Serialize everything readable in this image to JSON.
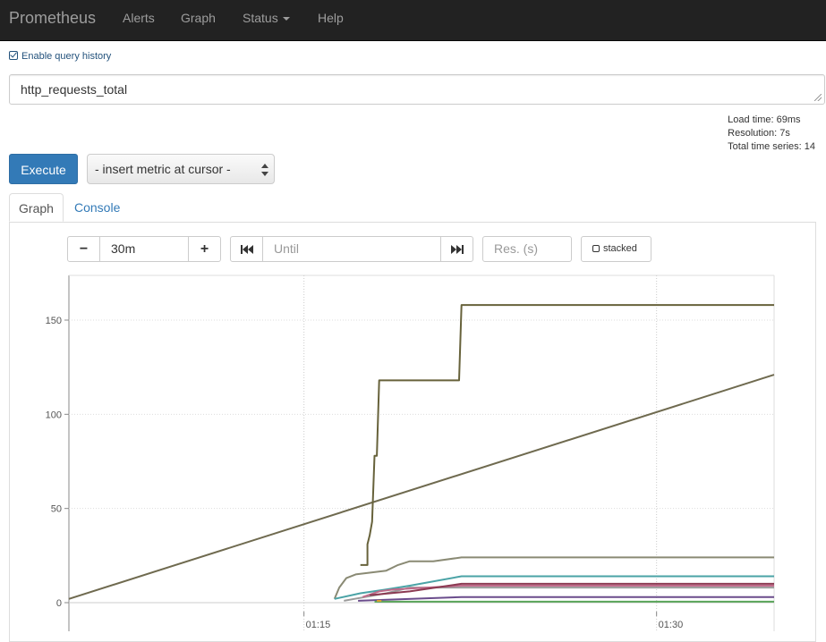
{
  "navbar": {
    "brand": "Prometheus",
    "items": [
      {
        "label": "Alerts"
      },
      {
        "label": "Graph"
      },
      {
        "label": "Status"
      },
      {
        "label": "Help"
      }
    ]
  },
  "history": {
    "label": "Enable query history",
    "checked": true
  },
  "query": {
    "value": "http_requests_total"
  },
  "stats": {
    "load_time": "Load time: 69ms",
    "resolution": "Resolution: 7s",
    "total_series": "Total time series: 14"
  },
  "execute": {
    "label": "Execute"
  },
  "metric_select": {
    "label": "- insert metric at cursor -"
  },
  "tabs": [
    {
      "label": "Graph",
      "active": true
    },
    {
      "label": "Console",
      "active": false
    }
  ],
  "controls": {
    "minus": "−",
    "range": "30m",
    "plus": "+",
    "until_placeholder": "Until",
    "res_placeholder": "Res. (s)",
    "stacked": "stacked"
  },
  "colors": {
    "navbar": "#222222",
    "accent": "#337ab7"
  },
  "chart_data": {
    "type": "line",
    "x_ticks": [
      "01:15",
      "01:30"
    ],
    "y_ticks": [
      0,
      50,
      100,
      150
    ],
    "ylim": [
      0,
      175
    ],
    "grid": true,
    "series": [
      {
        "color": "#6f6a4f",
        "points": [
          [
            0,
            2
          ],
          [
            30,
            121
          ]
        ]
      },
      {
        "color": "#67623b",
        "points": [
          [
            12.4,
            20
          ],
          [
            12.7,
            20
          ],
          [
            12.7,
            31
          ],
          [
            12.8,
            36
          ],
          [
            12.9,
            43
          ],
          [
            13.0,
            78
          ],
          [
            13.1,
            78
          ],
          [
            13.2,
            118
          ],
          [
            16.6,
            118
          ],
          [
            16.7,
            158
          ],
          [
            30,
            158
          ]
        ]
      },
      {
        "color": "#8a8a74",
        "points": [
          [
            11.3,
            2
          ],
          [
            11.5,
            8
          ],
          [
            11.8,
            13
          ],
          [
            12.2,
            15
          ],
          [
            13.5,
            17
          ],
          [
            14.0,
            20
          ],
          [
            14.5,
            22
          ],
          [
            15.5,
            22
          ],
          [
            16.7,
            24
          ],
          [
            30,
            24
          ]
        ]
      },
      {
        "color": "#4aa3a6",
        "points": [
          [
            11.3,
            2
          ],
          [
            12.4,
            5
          ],
          [
            13.5,
            7
          ],
          [
            14.5,
            9
          ],
          [
            16.7,
            14
          ],
          [
            30,
            14
          ]
        ]
      },
      {
        "color": "#9a9a9a",
        "points": [
          [
            11.7,
            1
          ],
          [
            12.6,
            3
          ],
          [
            13.5,
            5
          ],
          [
            14.5,
            8
          ],
          [
            30,
            8
          ]
        ]
      },
      {
        "color": "#c06a8a",
        "points": [
          [
            12.5,
            3
          ],
          [
            13.2,
            6
          ],
          [
            13.8,
            7
          ],
          [
            16.7,
            9
          ],
          [
            30,
            9
          ]
        ]
      },
      {
        "color": "#8b3a52",
        "points": [
          [
            12.8,
            4
          ],
          [
            14.5,
            6
          ],
          [
            16.7,
            10
          ],
          [
            30,
            10
          ]
        ]
      },
      {
        "color": "#6a4c8c",
        "points": [
          [
            12.3,
            1
          ],
          [
            16.7,
            3
          ],
          [
            30,
            3
          ]
        ]
      },
      {
        "color": "#5aa55a",
        "points": [
          [
            13.0,
            0.5
          ],
          [
            30,
            0.5
          ]
        ]
      },
      {
        "color": "#e0a030",
        "points": [
          [
            13.1,
            1
          ],
          [
            13.3,
            1
          ]
        ]
      }
    ]
  }
}
